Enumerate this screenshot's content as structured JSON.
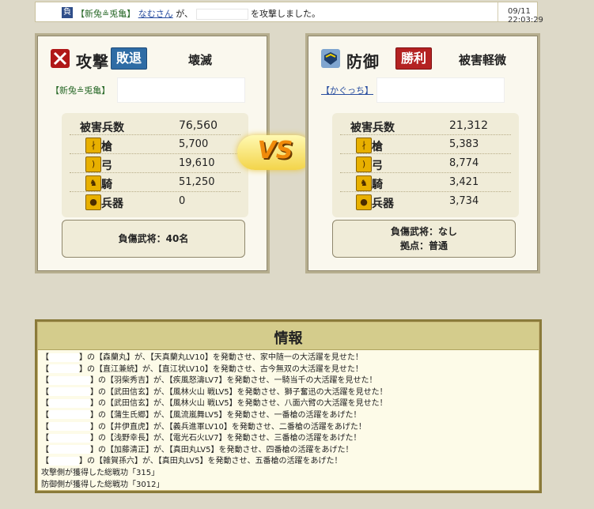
{
  "top": {
    "badge": "負",
    "alliance": "【新兔≗兎亀】",
    "player": "なむさん",
    "mid": "が、",
    "suffix": "を攻撃しました。",
    "time": "09/11 22:03:29"
  },
  "attack": {
    "role": "攻撃",
    "result": "敗退",
    "damage": "壊滅",
    "alliance": "【新兔≗兎亀】",
    "player": "",
    "stats": [
      {
        "label": "被害兵数",
        "value": "76,560",
        "icon": ""
      },
      {
        "label": "槍",
        "value": "5,700",
        "icon": "spear-icon"
      },
      {
        "label": "弓",
        "value": "19,610",
        "icon": "bow-icon"
      },
      {
        "label": "騎",
        "value": "51,250",
        "icon": "horse-icon"
      },
      {
        "label": "兵器",
        "value": "0",
        "icon": "weapon-icon"
      }
    ],
    "wounded": "負傷武将：40名",
    "base": ""
  },
  "defend": {
    "role": "防御",
    "result": "勝利",
    "damage": "被害軽微",
    "alliance": "【かぐっち】",
    "player": "",
    "stats": [
      {
        "label": "被害兵数",
        "value": "21,312",
        "icon": ""
      },
      {
        "label": "槍",
        "value": "5,383",
        "icon": "spear-icon"
      },
      {
        "label": "弓",
        "value": "8,774",
        "icon": "bow-icon"
      },
      {
        "label": "騎",
        "value": "3,421",
        "icon": "horse-icon"
      },
      {
        "label": "兵器",
        "value": "3,734",
        "icon": "weapon-icon"
      }
    ],
    "wounded": "負傷武将：なし",
    "base": "拠点：普通"
  },
  "vs": "VS",
  "info": {
    "title": "情報",
    "lines": [
      {
        "pre": "【",
        "post": "】の【森蘭丸】が、【天真蘭丸LV10】を発動させ、家中随一の大活躍を見せた！"
      },
      {
        "pre": "【",
        "post": "】の【直江兼続】が、【直江状LV10】を発動させ、古今無双の大活躍を見せた！"
      },
      {
        "pre": "【",
        "post": "】の【羽柴秀吉】が、【疾風怒濤LV7】を発動させ、一騎当千の大活躍を見せた！"
      },
      {
        "pre": "【",
        "post": "】の【武田信玄】が、【風林火山 戦LV5】を発動させ、獅子奮迅の大活躍を見せた！"
      },
      {
        "pre": "【",
        "post": "】の【武田信玄】が、【風林火山 戦LV5】を発動させ、八面六臂の大活躍を見せた！"
      },
      {
        "pre": "【",
        "post": "】の【蒲生氏郷】が、【風流嵐舞LV5】を発動させ、一番槍の活躍をあげた！"
      },
      {
        "pre": "【",
        "post": "】の【井伊直虎】が、【義兵進軍LV10】を発動させ、二番槍の活躍をあげた！"
      },
      {
        "pre": "【",
        "post": "】の【浅野幸長】が、【電光石火LV7】を発動させ、三番槍の活躍をあげた！"
      },
      {
        "pre": "【",
        "post": "】の【加藤清正】が、【真田丸LV5】を発動させ、四番槍の活躍をあげた！"
      },
      {
        "pre": "【",
        "post": "】の【雑賀孫六】が、【真田丸LV5】を発動させ、五番槍の活躍をあげた！"
      },
      {
        "pre": "",
        "post": "攻撃側が獲得した総戦功「315」"
      },
      {
        "pre": "",
        "post": "防御側が獲得した総戦功「3012」"
      }
    ]
  },
  "colors": {
    "background": "#ddd9c8",
    "lose_badge": "#2f6ca5",
    "win_badge": "#b42222",
    "link_green": "#2a6a2a",
    "link_blue": "#2a4fa0"
  }
}
